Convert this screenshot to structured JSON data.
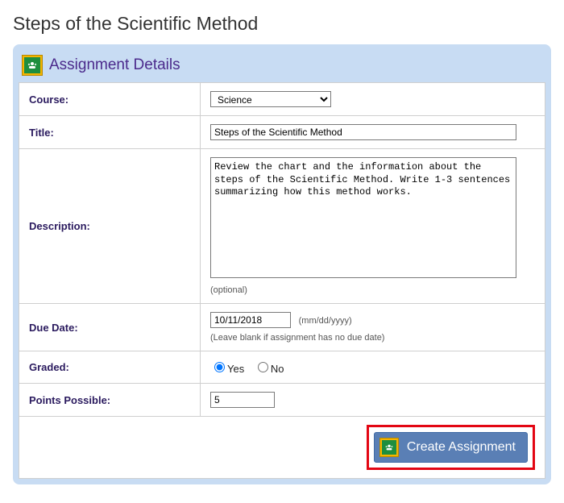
{
  "page": {
    "heading": "Steps of the Scientific Method"
  },
  "panel": {
    "title": "Assignment Details"
  },
  "form": {
    "course": {
      "label": "Course:",
      "value": "Science"
    },
    "title": {
      "label": "Title:",
      "value": "Steps of the Scientific Method"
    },
    "description": {
      "label": "Description:",
      "value": "Review the chart and the information about the steps of the Scientific Method. Write 1-3 sentences summarizing how this method works.",
      "hint": "(optional)"
    },
    "dueDate": {
      "label": "Due Date:",
      "value": "10/11/2018",
      "formatHint": "(mm/dd/yyyy)",
      "blankHint": "(Leave blank if assignment has no due date)"
    },
    "graded": {
      "label": "Graded:",
      "yes": "Yes",
      "no": "No",
      "selected": "yes"
    },
    "points": {
      "label": "Points Possible:",
      "value": "5"
    },
    "submitLabel": "Create Assignment"
  },
  "icons": {
    "classroom": "google-classroom-icon"
  }
}
